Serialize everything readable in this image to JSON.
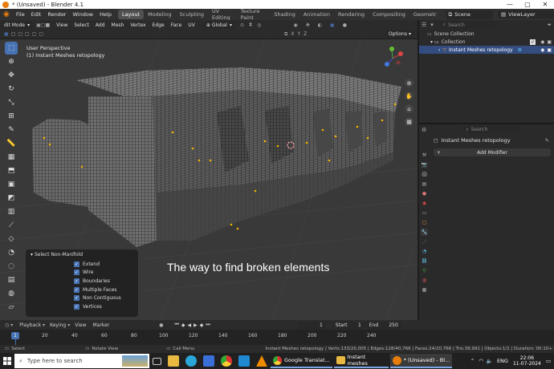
{
  "window": {
    "title": "* (Unsaved) - Blender 4.1",
    "controls": [
      "—",
      "▢",
      "✕"
    ]
  },
  "menubar": {
    "items": [
      "File",
      "Edit",
      "Render",
      "Window",
      "Help"
    ],
    "workspaces": [
      "Layout",
      "Modeling",
      "Sculpting",
      "UV Editing",
      "Texture Paint",
      "Shading",
      "Animation",
      "Rendering",
      "Compositing",
      "Geometr"
    ],
    "active_workspace": "Layout",
    "scene": "Scene",
    "view_layer": "ViewLayer"
  },
  "header": {
    "mode": "dit Mode",
    "menus": [
      "View",
      "Select",
      "Add",
      "Mesh",
      "Vertex",
      "Edge",
      "Face",
      "UV"
    ],
    "orientation": "Global",
    "options": "Options"
  },
  "viewport": {
    "view_name": "User Perspective",
    "object_label": "(1) Instant Meshes retopology",
    "overlay_caption": "The way to find broken elements"
  },
  "operator_panel": {
    "title": "Select Non-Manifold",
    "options": [
      "Extend",
      "Wire",
      "Boundaries",
      "Multiple Faces",
      "Non Contiguous",
      "Vertices"
    ]
  },
  "outliner": {
    "search_placeholder": "Search",
    "items": [
      "Scene Collection",
      "Collection",
      "Instant Meshes retopology"
    ]
  },
  "properties": {
    "search_placeholder": "Search",
    "object_name": "Instant Meshes retopology",
    "add_modifier": "Add Modifier"
  },
  "timeline": {
    "menus": [
      "Playback",
      "Keying",
      "View",
      "Marker"
    ],
    "current_frame": "1",
    "start_label": "Start",
    "start": "1",
    "end_label": "End",
    "end": "250",
    "ticks": [
      "1",
      "20",
      "40",
      "60",
      "80",
      "100",
      "120",
      "140",
      "160",
      "180",
      "200",
      "220",
      "240"
    ]
  },
  "statusbar": {
    "hints": [
      "Select",
      "Rotate View",
      "Call Menu"
    ],
    "stats": "Instant Meshes retopology | Verts:133/20,005 | Edges:128/40,766 | Faces:24/20,766 | Tris:39,991 | Objects:1/1 | Duration: 00:10+"
  },
  "taskbar": {
    "search_placeholder": "Type here to search",
    "apps": [
      "Google Translat...",
      "Instant meshes",
      "* (Unsaved) - Bl..."
    ],
    "lang": "ENG",
    "time": "22:06",
    "date": "11-07-2024"
  },
  "colors": {
    "accent": "#4772b3",
    "orange": "#e87d0d",
    "viewport_bg": "#393939",
    "selected_vertex": "#f0b000"
  }
}
